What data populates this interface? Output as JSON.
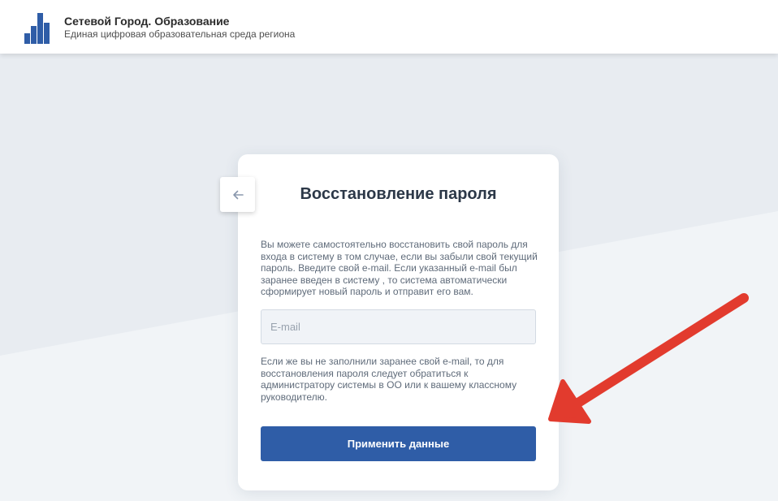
{
  "header": {
    "title": "Сетевой Город. Образование",
    "subtitle": "Единая цифровая образовательная среда региона",
    "logo_icon": "city-buildings-logo"
  },
  "card": {
    "back_icon": "arrow-left-icon",
    "title": "Восстановление пароля",
    "description": "Вы можете самостоятельно восстановить свой пароль для входа в систему в том случае, если вы забыли свой текущий пароль. Введите свой e-mail. Если указанный e-mail был заранее введен в систему , то система автоматически сформирует новый пароль и отправит его вам.",
    "email": {
      "value": "",
      "placeholder": "E-mail"
    },
    "note": "Если же вы не заполнили заранее свой e-mail, то для восстановления пароля следует обратиться к администратору системы в ОО или к вашему классному руководителю.",
    "submit_label": "Применить данные"
  },
  "colors": {
    "brand_blue": "#2f5da7",
    "annotation_arrow": "#e23b2e",
    "background": "#e9edf2"
  }
}
